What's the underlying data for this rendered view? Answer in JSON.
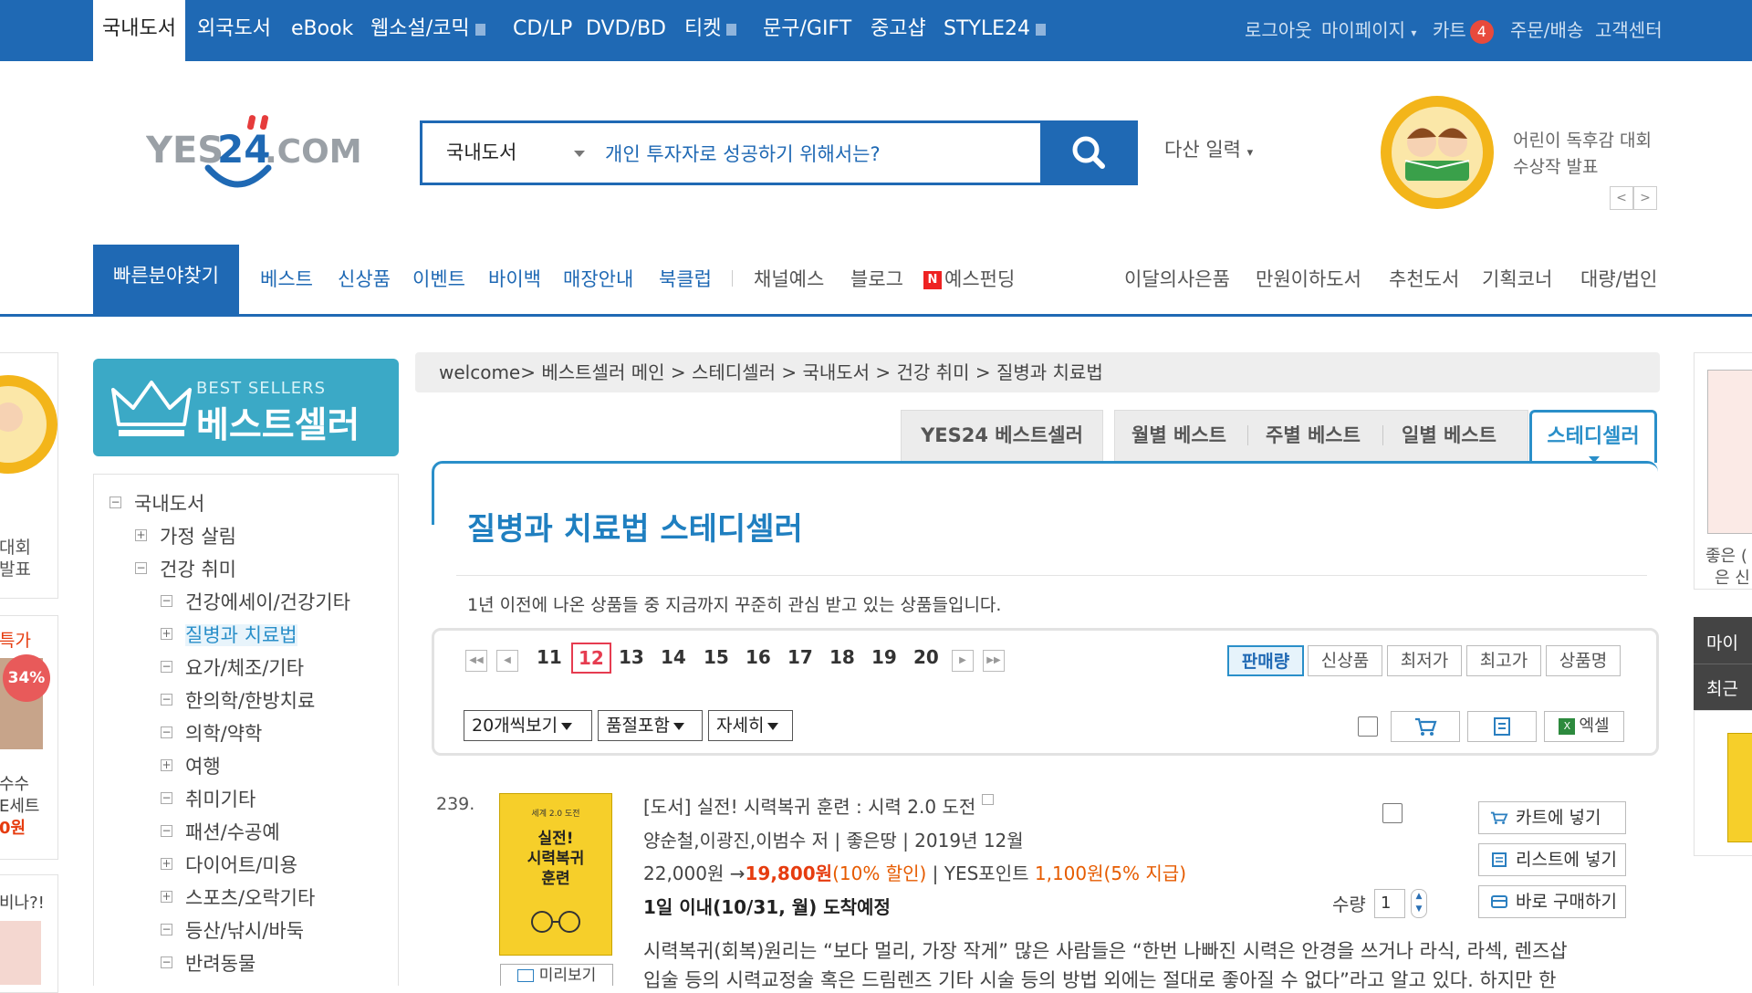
{
  "topbar": {
    "categories": [
      "국내도서",
      "외국도서",
      "eBook",
      "웹소설/코믹",
      "CD/LP",
      "DVD/BD",
      "티켓",
      "문구/GIFT",
      "중고샵",
      "STYLE24"
    ],
    "util": [
      "로그아웃",
      "마이페이지",
      "카트",
      "주문/배송",
      "고객센터"
    ],
    "cart_count": "4"
  },
  "header": {
    "search_scope": "국내도서",
    "search_value": "개인 투자자로 성공하기 위해서는?",
    "multi_input": "다산 일력",
    "promo_line1": "어린이 독후감 대회",
    "promo_line2": "수상작 발표"
  },
  "nav": {
    "quick": "빠른분야찾기",
    "left": [
      "베스트",
      "신상품",
      "이벤트",
      "바이백",
      "매장안내",
      "북클럽"
    ],
    "mid": [
      "채널예스",
      "블로그",
      "예스펀딩"
    ],
    "right": [
      "이달의사은품",
      "만원이하도서",
      "추천도서",
      "기획코너",
      "대량/법인"
    ]
  },
  "sidebar": {
    "banner_en": "BEST SELLERS",
    "banner_ko": "베스트셀러",
    "tree": [
      {
        "label": "국내도서",
        "level": 0,
        "sign": "−"
      },
      {
        "label": "가정 살림",
        "level": 1,
        "sign": "+"
      },
      {
        "label": "건강 취미",
        "level": 1,
        "sign": "−"
      },
      {
        "label": "건강에세이/건강기타",
        "level": 2,
        "sign": "−"
      },
      {
        "label": "질병과 치료법",
        "level": 2,
        "sign": "+"
      },
      {
        "label": "요가/체조/기타",
        "level": 2,
        "sign": "−"
      },
      {
        "label": "한의학/한방치료",
        "level": 2,
        "sign": "−"
      },
      {
        "label": "의학/약학",
        "level": 2,
        "sign": "−"
      },
      {
        "label": "여행",
        "level": 2,
        "sign": "+"
      },
      {
        "label": "취미기타",
        "level": 2,
        "sign": "−"
      },
      {
        "label": "패션/수공예",
        "level": 2,
        "sign": "−"
      },
      {
        "label": "다이어트/미용",
        "level": 2,
        "sign": "+"
      },
      {
        "label": "스포츠/오락기타",
        "level": 2,
        "sign": "+"
      },
      {
        "label": "등산/낚시/바둑",
        "level": 2,
        "sign": "−"
      },
      {
        "label": "반려동물",
        "level": 2,
        "sign": "−"
      }
    ]
  },
  "breadcrumb": "welcome> 베스트셀러 메인 > 스테디셀러 > 국내도서 > 건강 취미 > 질병과 치료법",
  "tabs": [
    "YES24 베스트셀러",
    "월별 베스트",
    "주별 베스트",
    "일별 베스트",
    "스테디셀러"
  ],
  "main": {
    "title": "질병과 치료법 스테디셀러",
    "description": "1년 이전에 나온 상품들 중 지금까지 꾸준히 관심 받고 있는 상품들입니다.",
    "pages": [
      "11",
      "12",
      "13",
      "14",
      "15",
      "16",
      "17",
      "18",
      "19",
      "20"
    ],
    "current_page": "12",
    "sort": [
      "판매량",
      "신상품",
      "최저가",
      "최고가",
      "상품명"
    ],
    "per_page": "20개씩보기",
    "stock_filter": "품절포함",
    "view_mode": "자세히",
    "excel": "엑셀"
  },
  "product": {
    "rank": "239.",
    "cover_top": "세계 2.0 도전",
    "cover_title": "실전!\n시력복귀\n훈련",
    "preview": "미리보기",
    "title": "[도서] 실전! 시력복귀 훈련 : 시력 2.0 도전",
    "meta": "양순철,이광진,이범수 저 | 좋은땅 | 2019년 12월",
    "list_price": "22,000원 →",
    "sale_price": "19,800원",
    "discount": "(10% 할인)",
    "points_label": " | YES포인트 ",
    "points": "1,100원",
    "points_rate": "(5% 지급)",
    "delivery": "1일 이내(10/31, 월) 도착예정",
    "qty_label": "수량",
    "qty": "1",
    "buttons": [
      "카트에 넣기",
      "리스트에 넣기",
      "바로 구매하기"
    ],
    "summary1": "시력복귀(회복)원리는 “보다 멀리, 가장 작게” 많은 사람들은 “한번 나빠진 시력은 안경을 쓰거나 라식, 라섹, 렌즈삽",
    "summary2": "입술 등의 시력교정술 혹은 드림렌즈 기타 시술 등의 방법 외에는 절대로 좋아질 수 없다”라고 알고 있다. 하지만 한"
  },
  "left_edge": {
    "t1": "대회",
    "t2": "발표",
    "t3": "특가",
    "badge": "34%",
    "t4": "수수",
    "t5": "E세트",
    "t6": "0원",
    "t7": "비나?!"
  },
  "right_edge": {
    "t1": "좋은 (",
    "t2": "은 신",
    "t3": "마이",
    "t4": "최근"
  },
  "colors": {
    "brand": "#1f69b4",
    "accent": "#2a8fc9",
    "sale": "#e63c0f"
  }
}
